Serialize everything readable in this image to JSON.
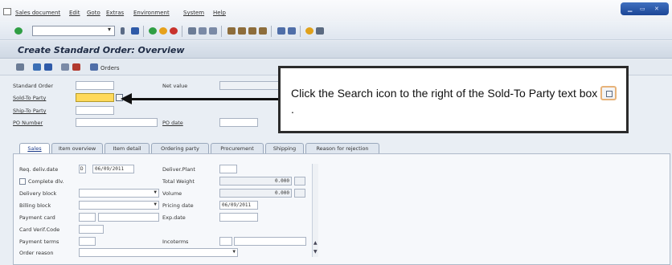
{
  "menubar": {
    "items": [
      "Sales document",
      "Edit",
      "Goto",
      "Extras",
      "Environment",
      "System",
      "Help"
    ]
  },
  "toolbar": {
    "command_field": ""
  },
  "screen": {
    "title": "Create Standard Order: Overview",
    "orders_button": "Orders"
  },
  "header_fields": {
    "standard_order_label": "Standard Order",
    "standard_order_value": "",
    "net_value_label": "Net value",
    "net_value_value": "",
    "sold_to_label": "Sold-To Party",
    "sold_to_value": "",
    "ship_to_label": "Ship-To Party",
    "ship_to_value": "",
    "po_number_label": "PO Number",
    "po_number_value": "",
    "po_date_label": "PO date",
    "po_date_value": ""
  },
  "callout": {
    "text": "Click the Search icon to the right of the Sold-To Party text box",
    "suffix": "."
  },
  "tabs": [
    {
      "label": "Sales"
    },
    {
      "label": "Item overview"
    },
    {
      "label": "Item detail"
    },
    {
      "label": "Ordering party"
    },
    {
      "label": "Procurement"
    },
    {
      "label": "Shipping"
    },
    {
      "label": "Reason for rejection"
    }
  ],
  "sales_tab": {
    "req_deliv_date_label": "Req. deliv.date",
    "req_deliv_date_format": "D",
    "req_deliv_date_value": "06/09/2011",
    "deliver_plant_label": "Deliver.Plant",
    "deliver_plant_value": "",
    "complete_dlv_label": "Complete dlv.",
    "total_weight_label": "Total Weight",
    "total_weight_value": "0.000",
    "delivery_block_label": "Delivery block",
    "volume_label": "Volume",
    "volume_value": "0.000",
    "billing_block_label": "Billing block",
    "pricing_date_label": "Pricing date",
    "pricing_date_value": "06/09/2011",
    "payment_card_label": "Payment card",
    "exp_date_label": "Exp.date",
    "card_verif_label": "Card Verif.Code",
    "payment_terms_label": "Payment terms",
    "incoterms_label": "Incoterms",
    "order_reason_label": "Order reason"
  }
}
